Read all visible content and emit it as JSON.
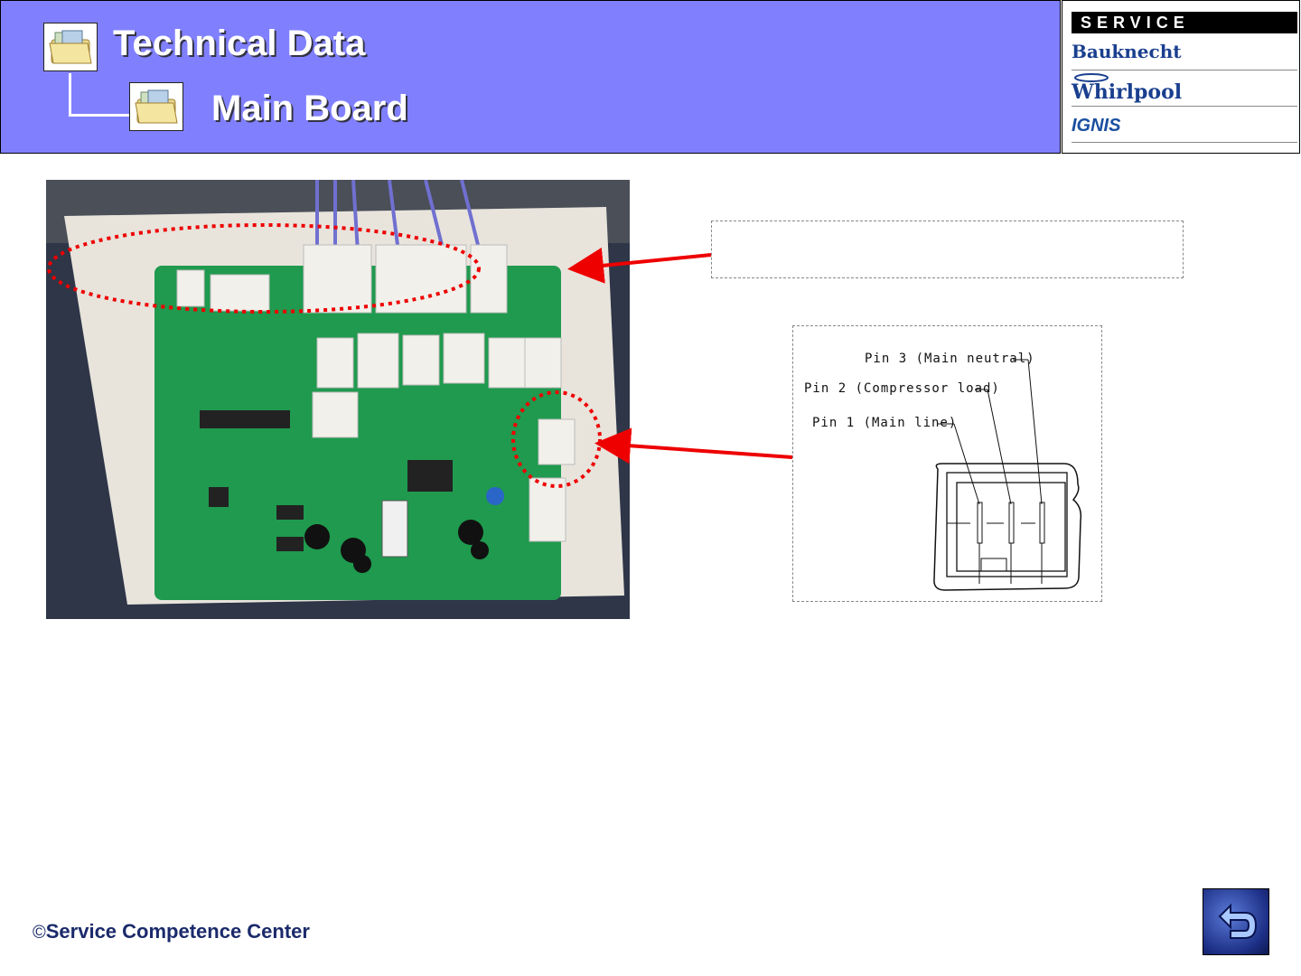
{
  "header": {
    "title": "Technical Data",
    "subtitle": "Main Board",
    "folder_icon": "folder-icon"
  },
  "brands": {
    "service_label": "SERVICE",
    "items": [
      "Bauknecht",
      "Whirlpool",
      "IGNIS"
    ]
  },
  "diagram": {
    "pins": [
      "Pin 3 (Main neutral)",
      "Pin 2 (Compressor load)",
      "Pin 1 (Main line)"
    ]
  },
  "footer": {
    "copyright_symbol": "©",
    "text": "Service Competence Center"
  },
  "nav": {
    "back_icon": "back-arrow-icon"
  },
  "colors": {
    "header_bg": "#8080ff",
    "annotation": "#ee0000"
  }
}
